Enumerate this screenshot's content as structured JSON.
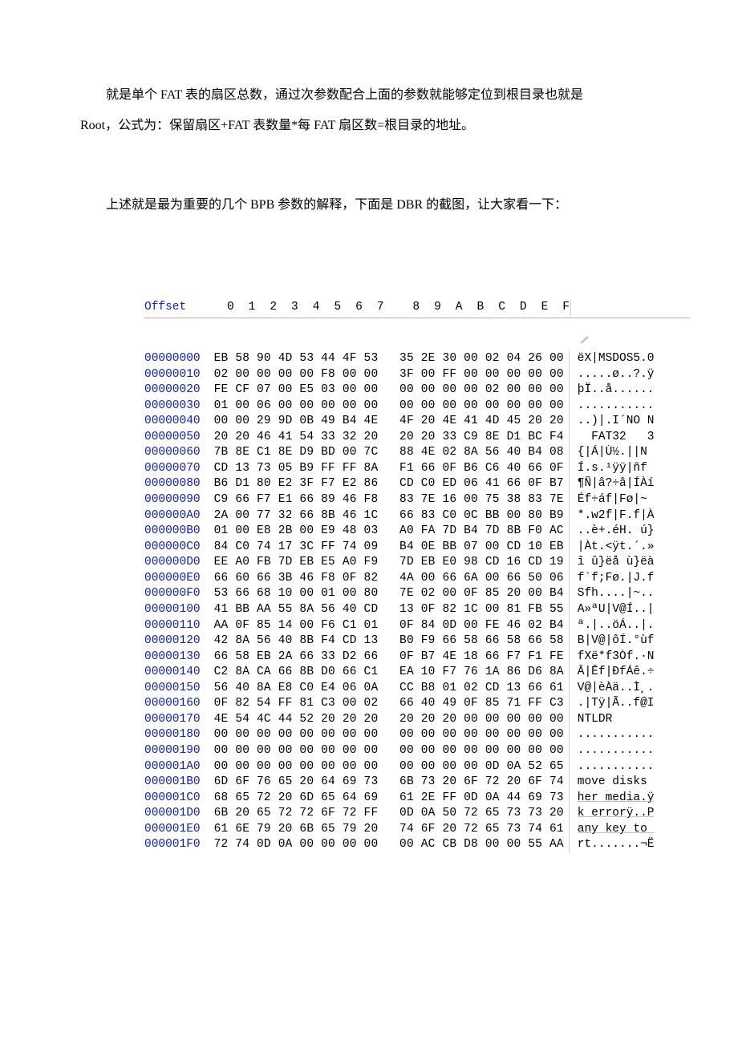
{
  "paragraphs": {
    "p1a": "就是单个 FAT 表的扇区总数，通过次参数配合上面的参数就能够定位到根目录也就是",
    "p1b": "Root，公式为：保留扇区+FAT 表数量*每 FAT 扇区数=根目录的地址。",
    "p2": "上述就是最为重要的几个 BPB 参数的解释，下面是 DBR 的截图，让大家看一下："
  },
  "hex": {
    "header_offset": "Offset",
    "header_cols": [
      "0",
      "1",
      "2",
      "3",
      "4",
      "5",
      "6",
      "7",
      "8",
      "9",
      "A",
      "B",
      "C",
      "D",
      "E",
      "F"
    ],
    "rows": [
      {
        "o": "00000000",
        "h": [
          "EB",
          "58",
          "90",
          "4D",
          "53",
          "44",
          "4F",
          "53",
          "35",
          "2E",
          "30",
          "00",
          "02",
          "04",
          "26",
          "00"
        ],
        "a": "ëX|MSDOS5.0"
      },
      {
        "o": "00000010",
        "h": [
          "02",
          "00",
          "00",
          "00",
          "00",
          "F8",
          "00",
          "00",
          "3F",
          "00",
          "FF",
          "00",
          "00",
          "00",
          "00",
          "00"
        ],
        "a": ".....ø..?.ÿ"
      },
      {
        "o": "00000020",
        "h": [
          "FE",
          "CF",
          "07",
          "00",
          "E5",
          "03",
          "00",
          "00",
          "00",
          "00",
          "00",
          "00",
          "02",
          "00",
          "00",
          "00"
        ],
        "a": "þÏ..å......"
      },
      {
        "o": "00000030",
        "h": [
          "01",
          "00",
          "06",
          "00",
          "00",
          "00",
          "00",
          "00",
          "00",
          "00",
          "00",
          "00",
          "00",
          "00",
          "00",
          "00"
        ],
        "a": "..........."
      },
      {
        "o": "00000040",
        "h": [
          "00",
          "00",
          "29",
          "9D",
          "0B",
          "49",
          "B4",
          "4E",
          "4F",
          "20",
          "4E",
          "41",
          "4D",
          "45",
          "20",
          "20"
        ],
        "a": "..)|.I´NO N"
      },
      {
        "o": "00000050",
        "h": [
          "20",
          "20",
          "46",
          "41",
          "54",
          "33",
          "32",
          "20",
          "20",
          "20",
          "33",
          "C9",
          "8E",
          "D1",
          "BC",
          "F4"
        ],
        "a": "  FAT32   3"
      },
      {
        "o": "00000060",
        "h": [
          "7B",
          "8E",
          "C1",
          "8E",
          "D9",
          "BD",
          "00",
          "7C",
          "88",
          "4E",
          "02",
          "8A",
          "56",
          "40",
          "B4",
          "08"
        ],
        "a": "{|Á|Ù½.||N"
      },
      {
        "o": "00000070",
        "h": [
          "CD",
          "13",
          "73",
          "05",
          "B9",
          "FF",
          "FF",
          "8A",
          "F1",
          "66",
          "0F",
          "B6",
          "C6",
          "40",
          "66",
          "0F"
        ],
        "a": "Í.s.¹ÿÿ|ñf"
      },
      {
        "o": "00000080",
        "h": [
          "B6",
          "D1",
          "80",
          "E2",
          "3F",
          "F7",
          "E2",
          "86",
          "CD",
          "C0",
          "ED",
          "06",
          "41",
          "66",
          "0F",
          "B7"
        ],
        "a": "¶Ñ|â?÷â|ÍÀí"
      },
      {
        "o": "00000090",
        "h": [
          "C9",
          "66",
          "F7",
          "E1",
          "66",
          "89",
          "46",
          "F8",
          "83",
          "7E",
          "16",
          "00",
          "75",
          "38",
          "83",
          "7E"
        ],
        "a": "Éf÷áf|Fø|~"
      },
      {
        "o": "000000A0",
        "h": [
          "2A",
          "00",
          "77",
          "32",
          "66",
          "8B",
          "46",
          "1C",
          "66",
          "83",
          "C0",
          "0C",
          "BB",
          "00",
          "80",
          "B9"
        ],
        "a": "*.w2f|F.f|À"
      },
      {
        "o": "000000B0",
        "h": [
          "01",
          "00",
          "E8",
          "2B",
          "00",
          "E9",
          "48",
          "03",
          "A0",
          "FA",
          "7D",
          "B4",
          "7D",
          "8B",
          "F0",
          "AC"
        ],
        "a": "..è+.éH. ú}"
      },
      {
        "o": "000000C0",
        "h": [
          "84",
          "C0",
          "74",
          "17",
          "3C",
          "FF",
          "74",
          "09",
          "B4",
          "0E",
          "BB",
          "07",
          "00",
          "CD",
          "10",
          "EB"
        ],
        "a": "|Àt.<ÿt.´.»"
      },
      {
        "o": "000000D0",
        "h": [
          "EE",
          "A0",
          "FB",
          "7D",
          "EB",
          "E5",
          "A0",
          "F9",
          "7D",
          "EB",
          "E0",
          "98",
          "CD",
          "16",
          "CD",
          "19"
        ],
        "a": "î û}ëå ù}ëà"
      },
      {
        "o": "000000E0",
        "h": [
          "66",
          "60",
          "66",
          "3B",
          "46",
          "F8",
          "0F",
          "82",
          "4A",
          "00",
          "66",
          "6A",
          "00",
          "66",
          "50",
          "06"
        ],
        "a": "f`f;Fø.|J.f"
      },
      {
        "o": "000000F0",
        "h": [
          "53",
          "66",
          "68",
          "10",
          "00",
          "01",
          "00",
          "80",
          "7E",
          "02",
          "00",
          "0F",
          "85",
          "20",
          "00",
          "B4"
        ],
        "a": "Sfh....|~.."
      },
      {
        "o": "00000100",
        "h": [
          "41",
          "BB",
          "AA",
          "55",
          "8A",
          "56",
          "40",
          "CD",
          "13",
          "0F",
          "82",
          "1C",
          "00",
          "81",
          "FB",
          "55"
        ],
        "a": "A»ªU|V@Í..|"
      },
      {
        "o": "00000110",
        "h": [
          "AA",
          "0F",
          "85",
          "14",
          "00",
          "F6",
          "C1",
          "01",
          "0F",
          "84",
          "0D",
          "00",
          "FE",
          "46",
          "02",
          "B4"
        ],
        "a": "ª.|..öÁ..|."
      },
      {
        "o": "00000120",
        "h": [
          "42",
          "8A",
          "56",
          "40",
          "8B",
          "F4",
          "CD",
          "13",
          "B0",
          "F9",
          "66",
          "58",
          "66",
          "58",
          "66",
          "58"
        ],
        "a": "B|V@|ôÍ.°ùf"
      },
      {
        "o": "00000130",
        "h": [
          "66",
          "58",
          "EB",
          "2A",
          "66",
          "33",
          "D2",
          "66",
          "0F",
          "B7",
          "4E",
          "18",
          "66",
          "F7",
          "F1",
          "FE"
        ],
        "a": "fXë*f3Òf.·N"
      },
      {
        "o": "00000140",
        "h": [
          "C2",
          "8A",
          "CA",
          "66",
          "8B",
          "D0",
          "66",
          "C1",
          "EA",
          "10",
          "F7",
          "76",
          "1A",
          "86",
          "D6",
          "8A"
        ],
        "a": "Â|Êf|ÐfÁê.÷"
      },
      {
        "o": "00000150",
        "h": [
          "56",
          "40",
          "8A",
          "E8",
          "C0",
          "E4",
          "06",
          "0A",
          "CC",
          "B8",
          "01",
          "02",
          "CD",
          "13",
          "66",
          "61"
        ],
        "a": "V@|èÀä..Ì¸."
      },
      {
        "o": "00000160",
        "h": [
          "0F",
          "82",
          "54",
          "FF",
          "81",
          "C3",
          "00",
          "02",
          "66",
          "40",
          "49",
          "0F",
          "85",
          "71",
          "FF",
          "C3"
        ],
        "a": ".|Tÿ|Ã..f@I"
      },
      {
        "o": "00000170",
        "h": [
          "4E",
          "54",
          "4C",
          "44",
          "52",
          "20",
          "20",
          "20",
          "20",
          "20",
          "20",
          "00",
          "00",
          "00",
          "00",
          "00"
        ],
        "a": "NTLDR      "
      },
      {
        "o": "00000180",
        "h": [
          "00",
          "00",
          "00",
          "00",
          "00",
          "00",
          "00",
          "00",
          "00",
          "00",
          "00",
          "00",
          "00",
          "00",
          "00",
          "00"
        ],
        "a": "..........."
      },
      {
        "o": "00000190",
        "h": [
          "00",
          "00",
          "00",
          "00",
          "00",
          "00",
          "00",
          "00",
          "00",
          "00",
          "00",
          "00",
          "00",
          "00",
          "00",
          "00"
        ],
        "a": "..........."
      },
      {
        "o": "000001A0",
        "h": [
          "00",
          "00",
          "00",
          "00",
          "00",
          "00",
          "00",
          "00",
          "00",
          "00",
          "00",
          "00",
          "0D",
          "0A",
          "52",
          "65"
        ],
        "a": "..........."
      },
      {
        "o": "000001B0",
        "h": [
          "6D",
          "6F",
          "76",
          "65",
          "20",
          "64",
          "69",
          "73",
          "6B",
          "73",
          "20",
          "6F",
          "72",
          "20",
          "6F",
          "74"
        ],
        "a": "move disks "
      },
      {
        "o": "000001C0",
        "h": [
          "68",
          "65",
          "72",
          "20",
          "6D",
          "65",
          "64",
          "69",
          "61",
          "2E",
          "FF",
          "0D",
          "0A",
          "44",
          "69",
          "73"
        ],
        "a": "her media.ÿ",
        "underline": true
      },
      {
        "o": "000001D0",
        "h": [
          "6B",
          "20",
          "65",
          "72",
          "72",
          "6F",
          "72",
          "FF",
          "0D",
          "0A",
          "50",
          "72",
          "65",
          "73",
          "73",
          "20"
        ],
        "a": "k errorÿ..P",
        "underline": true
      },
      {
        "o": "000001E0",
        "h": [
          "61",
          "6E",
          "79",
          "20",
          "6B",
          "65",
          "79",
          "20",
          "74",
          "6F",
          "20",
          "72",
          "65",
          "73",
          "74",
          "61"
        ],
        "a": "any key to ",
        "underline": true
      },
      {
        "o": "000001F0",
        "h": [
          "72",
          "74",
          "0D",
          "0A",
          "00",
          "00",
          "00",
          "00",
          "00",
          "AC",
          "CB",
          "D8",
          "00",
          "00",
          "55",
          "AA"
        ],
        "a": "rt.......¬Ë"
      }
    ]
  }
}
